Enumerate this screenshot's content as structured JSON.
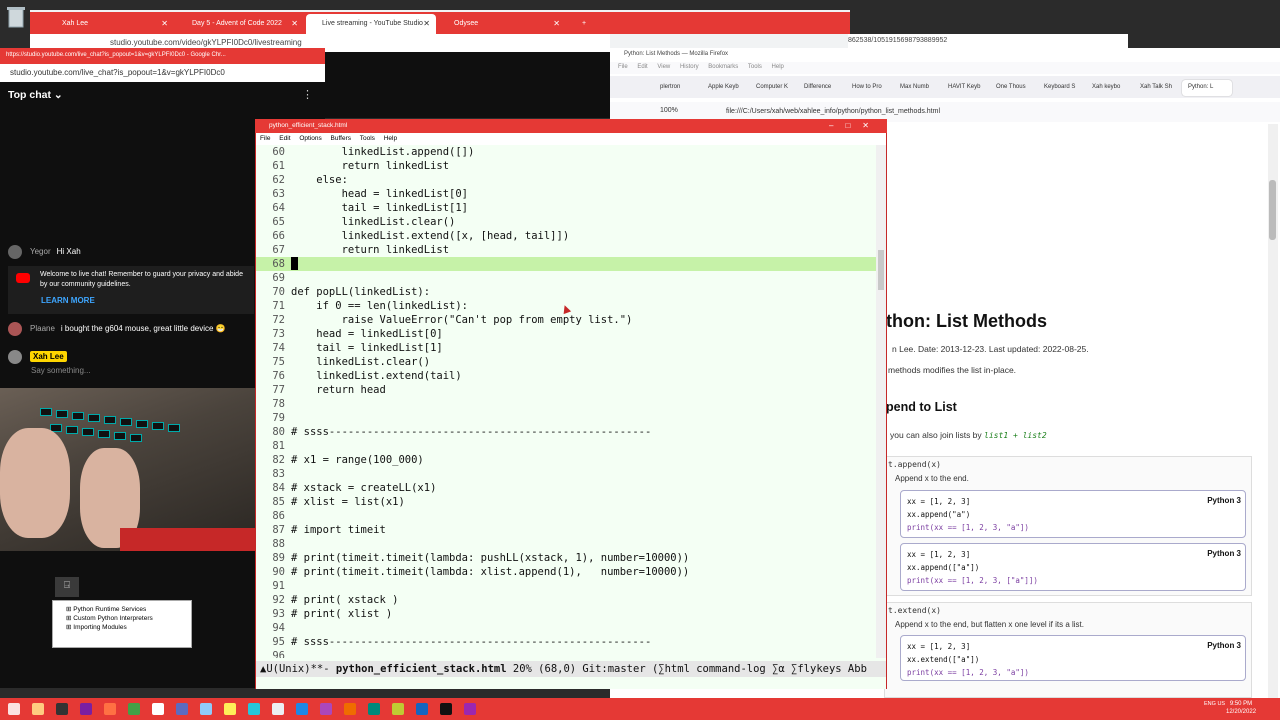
{
  "chrome": {
    "tabs": [
      {
        "label": "Xah Lee",
        "active": false
      },
      {
        "label": "Day 5 - Advent of Code 2022",
        "active": false
      },
      {
        "label": "Live streaming - YouTube Studio",
        "active": true
      },
      {
        "label": "Odysee",
        "active": false
      }
    ],
    "url": "studio.youtube.com/video/gkYLPFI0Dc0/livestreaming",
    "second_url": "862538/1051915698793889952"
  },
  "yt_chat": {
    "title": "https://studio.youtube.com/live_chat?is_popout=1&v=gkYLPFI0Dc0 - Google Chr...",
    "url": "studio.youtube.com/live_chat?is_popout=1&v=gkYLPFI0Dc0",
    "top_chat": "Top chat",
    "messages": [
      {
        "author": "Yegor",
        "text": "Hi Xah"
      },
      {
        "author": "Plaane",
        "text": "i bought the g604 mouse, great little device 😁"
      },
      {
        "author": "Xah Lee",
        "text": ""
      }
    ],
    "welcome": "Welcome to live chat! Remember to guard your privacy and abide by our community guidelines.",
    "learn_more": "LEARN MORE",
    "say_something": "Say something..."
  },
  "tree": {
    "items": [
      "Python Runtime Services",
      "Custom Python Interpreters",
      "Importing Modules"
    ]
  },
  "firefox": {
    "title": "Python: List Methods — Mozilla Firefox",
    "menu": [
      "File",
      "Edit",
      "View",
      "History",
      "Bookmarks",
      "Tools",
      "Help"
    ],
    "tabs": [
      "plertron",
      "Apple Keyb",
      "Computer K",
      "Difference",
      "How to Pro",
      "Max Numb",
      "HAVIT Keyb",
      "One Thous",
      "Keyboard S",
      "Xah keybo",
      "Xah Talk Sh",
      "Python: L"
    ],
    "zoom": "100%",
    "url": "file:///C:/Users/xah/web/xahlee_info/python/python_list_methods.html",
    "page": {
      "h1": "thon: List Methods",
      "author": "n Lee. Date: 2013-12-23. Last updated: 2022-08-25.",
      "intro": "methods modifies the list in-place.",
      "h2": "pend to List",
      "join_text": "you can also join lists by",
      "join_code": "list1 + list2",
      "append_sig": "t.append(x)",
      "append_desc": "Append x to the end.",
      "extend_sig": "t.extend(x)",
      "extend_desc": "Append x to the end, but flatten x one level if its a list.",
      "lang": "Python 3",
      "cards": [
        [
          "xx = [1, 2, 3]",
          "xx.append(\"a\")",
          "print(xx == [1, 2, 3, \"a\"])"
        ],
        [
          "xx = [1, 2, 3]",
          "xx.append([\"a\"])",
          "print(xx == [1, 2, 3, [\"a\"]])"
        ],
        [
          "xx = [1, 2, 3]",
          "xx.extend([\"a\"])",
          "print(xx == [1, 2, 3, \"a\"])"
        ]
      ]
    }
  },
  "emacs": {
    "title": "python_efficient_stack.html",
    "menu": [
      "File",
      "Edit",
      "Options",
      "Buffers",
      "Tools",
      "Help"
    ],
    "lines": [
      {
        "n": "60",
        "t": "        linkedList.append([])"
      },
      {
        "n": "61",
        "t": "        return linkedList"
      },
      {
        "n": "62",
        "t": "    else:"
      },
      {
        "n": "63",
        "t": "        head = linkedList[0]"
      },
      {
        "n": "64",
        "t": "        tail = linkedList[1]"
      },
      {
        "n": "65",
        "t": "        linkedList.clear()"
      },
      {
        "n": "66",
        "t": "        linkedList.extend([x, [head, tail]])"
      },
      {
        "n": "67",
        "t": "        return linkedList"
      },
      {
        "n": "68",
        "t": ""
      },
      {
        "n": "69",
        "t": ""
      },
      {
        "n": "70",
        "t": "def popLL(linkedList):"
      },
      {
        "n": "71",
        "t": "    if 0 == len(linkedList):"
      },
      {
        "n": "72",
        "t": "        raise ValueError(\"Can't pop from empty list.\")"
      },
      {
        "n": "73",
        "t": "    head = linkedList[0]"
      },
      {
        "n": "74",
        "t": "    tail = linkedList[1]"
      },
      {
        "n": "75",
        "t": "    linkedList.clear()"
      },
      {
        "n": "76",
        "t": "    linkedList.extend(tail)"
      },
      {
        "n": "77",
        "t": "    return head"
      },
      {
        "n": "78",
        "t": ""
      },
      {
        "n": "79",
        "t": ""
      },
      {
        "n": "80",
        "t": "# ssss---------------------------------------------------"
      },
      {
        "n": "81",
        "t": ""
      },
      {
        "n": "82",
        "t": "# x1 = range(100_000)"
      },
      {
        "n": "83",
        "t": ""
      },
      {
        "n": "84",
        "t": "# xstack = createLL(x1)"
      },
      {
        "n": "85",
        "t": "# xlist = list(x1)"
      },
      {
        "n": "86",
        "t": ""
      },
      {
        "n": "87",
        "t": "# import timeit"
      },
      {
        "n": "88",
        "t": ""
      },
      {
        "n": "89",
        "t": "# print(timeit.timeit(lambda: pushLL(xstack, 1), number=10000))"
      },
      {
        "n": "90",
        "t": "# print(timeit.timeit(lambda: xlist.append(1),   number=10000))"
      },
      {
        "n": "91",
        "t": ""
      },
      {
        "n": "92",
        "t": "# print( xstack )"
      },
      {
        "n": "93",
        "t": "# print( xlist )"
      },
      {
        "n": "94",
        "t": ""
      },
      {
        "n": "95",
        "t": "# ssss---------------------------------------------------"
      },
      {
        "n": "96",
        "t": ""
      }
    ],
    "current_line": "68",
    "modeline_prefix": "U(Unix)**- ",
    "modeline_buffer": "python_efficient_stack.html",
    "modeline_rest": " 20% (68,0) Git:master (∑html command-log ∑α ∑flykeys Abb"
  },
  "taskbar": {
    "lang": "ENG US",
    "time": "9:50 PM",
    "date": "12/20/2022"
  },
  "colors": {
    "accent_red": "#e53935",
    "editor_bg": "#f4fff4",
    "current_line": "#c6f2a8",
    "yt_link": "#3ea6ff"
  }
}
